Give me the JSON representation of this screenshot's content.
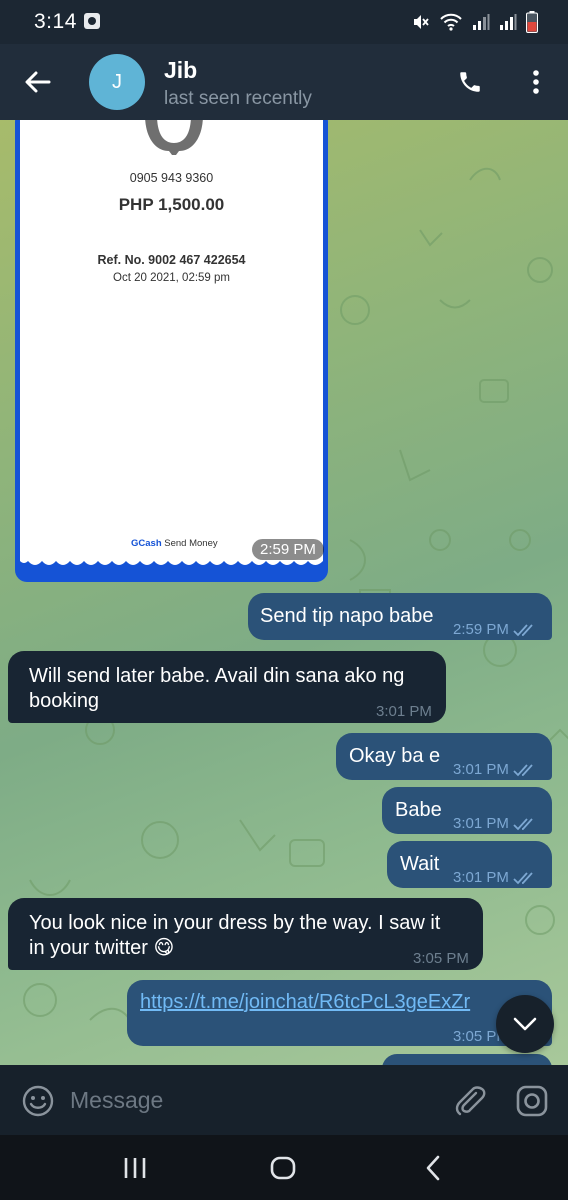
{
  "status_bar": {
    "time": "3:14",
    "icons": [
      "screenshot-icon",
      "mute-icon",
      "wifi-icon",
      "signal-icon",
      "signal-icon",
      "battery-icon"
    ]
  },
  "header": {
    "avatar_initial": "J",
    "avatar_color": "#5fb4d6",
    "name": "Jib",
    "status": "last seen recently",
    "icons": [
      "back-arrow-icon",
      "phone-icon",
      "more-vert-icon"
    ]
  },
  "receipt": {
    "phone": "0905 943 9360",
    "amount": "PHP 1,500.00",
    "ref": "Ref. No. 9002 467 422654",
    "date": "Oct 20 2021, 02:59 pm",
    "brand": "GCash",
    "service": "Send Money",
    "time": "2:59 PM"
  },
  "messages": [
    {
      "dir": "out",
      "text": "Send tip napo babe",
      "time": "2:59 PM",
      "read": true
    },
    {
      "dir": "in",
      "line1": "Will send later babe. Avail din sana ako ng",
      "line2": "booking",
      "time": "3:01 PM"
    },
    {
      "dir": "out",
      "text": "Okay ba e",
      "time": "3:01 PM",
      "read": true
    },
    {
      "dir": "out",
      "text": "Babe",
      "time": "3:01 PM",
      "read": true
    },
    {
      "dir": "out",
      "text": "Wait",
      "time": "3:01 PM",
      "read": true
    },
    {
      "dir": "in",
      "line1": "You look nice in your dress by the way. I saw it",
      "line2": "in your twitter 😋",
      "time": "3:05 PM"
    },
    {
      "dir": "out",
      "text": "https://t.me/joinchat/R6tcPcL3geExZr",
      "time": "3:05 PM",
      "read": true
    }
  ],
  "colors": {
    "bubble_out": "#2b5278",
    "bubble_in": "#182533",
    "header": "#212d3b",
    "gcash_blue": "#1553d6"
  },
  "input": {
    "placeholder": "Message"
  }
}
